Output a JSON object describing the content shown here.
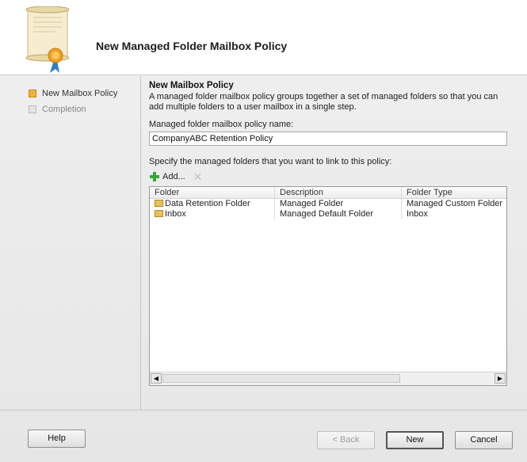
{
  "window": {
    "title": "New Managed Folder Mailbox Policy"
  },
  "nav": {
    "items": [
      {
        "label": "New Mailbox Policy",
        "state": "active"
      },
      {
        "label": "Completion",
        "state": "inactive"
      }
    ]
  },
  "page": {
    "section_title": "New Mailbox Policy",
    "description_line1": "A managed folder mailbox policy groups together a set of managed folders so that you can",
    "description_line2": "add multiple folders to a user mailbox in a single step.",
    "name_label": "Managed folder mailbox policy name:",
    "name_value": "CompanyABC Retention Policy",
    "specify_label": "Specify the managed folders that you want to link to this policy:"
  },
  "toolbar": {
    "add_label": "Add...",
    "delete_icon": "delete-x-icon"
  },
  "grid": {
    "columns": [
      "Folder",
      "Description",
      "Folder Type"
    ],
    "rows": [
      {
        "folder": "Data Retention Folder",
        "description": "Managed Folder",
        "type": "Managed Custom Folder"
      },
      {
        "folder": "Inbox",
        "description": "Managed Default Folder",
        "type": "Inbox"
      }
    ]
  },
  "footer": {
    "help": "Help",
    "back": "< Back",
    "new": "New",
    "cancel": "Cancel"
  },
  "colors": {
    "accent": "#f2b233",
    "background": "#ececec"
  }
}
